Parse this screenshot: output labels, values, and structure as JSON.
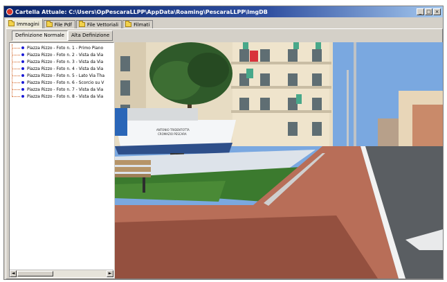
{
  "window": {
    "title": "Cartella Attuale: C:\\Users\\OpPescaraLLPP\\AppData\\Roaming\\PescaraLLPP\\ImgDB",
    "buttons": [
      "_",
      "□",
      "×"
    ]
  },
  "tabs": [
    {
      "label": "Immagini",
      "active": true,
      "icon": "folder-icon"
    },
    {
      "label": "File Pdf",
      "active": false,
      "icon": "folder-icon"
    },
    {
      "label": "File Vettoriali",
      "active": false,
      "icon": "folder-icon"
    },
    {
      "label": "Filmati",
      "active": false,
      "icon": "folder-icon"
    }
  ],
  "subtoolbar": {
    "normal_label": "Definizione Normale",
    "high_label": "Alta Definizione"
  },
  "tree": {
    "items": [
      "Piazza Rizzo - Foto n. 1 - Primo Piano",
      "Piazza Rizzo - Foto n. 2 - Vista da Via",
      "Piazza Rizzo - Foto n. 3 - Vista da Via",
      "Piazza Rizzo - Foto n. 4 - Vista da Via",
      "Piazza Rizzo - Foto n. 5 - Lato Via Tha",
      "Piazza Rizzo - Foto n. 6 - Scorcio su V",
      "Piazza Rizzo - Foto n. 7 - Vista da Via",
      "Piazza Rizzo - Foto n. 8 - Vista da Via"
    ],
    "bullet_color": "#1b1bd6",
    "line_color": "#d06020"
  },
  "scrollbar": {
    "left_arrow": "◄",
    "right_arrow": "►"
  },
  "photo": {
    "boat_text_line1": "ANTONIO TRIDENTOTTA",
    "boat_text_line2": "CROMAZIO PESCARA",
    "sky_color": "#7aa8e0",
    "pavement_color": "#b86e58"
  }
}
